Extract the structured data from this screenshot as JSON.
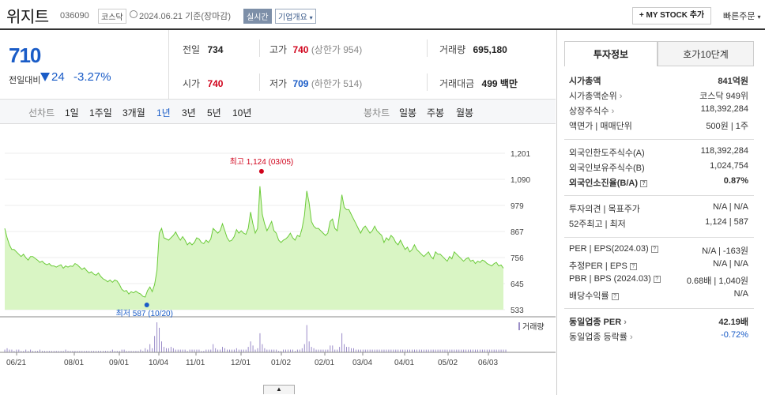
{
  "header": {
    "name": "위지트",
    "code": "036090",
    "market": "코스닥",
    "date_text": "2024.06.21  기준(장마감)",
    "live_tag": "실시간",
    "company_info": "기업개요",
    "mystock_button": "+ MY STOCK 추가",
    "quick_order": "빠른주문"
  },
  "price": {
    "current": "710",
    "change_label": "전일대비",
    "change": "24",
    "change_pct": "-3.27%"
  },
  "stats": {
    "prev_label": "전일",
    "prev": "734",
    "high_label": "고가",
    "high": "740",
    "upper_limit": "(상한가 954)",
    "volume_label": "거래량",
    "volume": "695,180",
    "open_label": "시가",
    "open": "740",
    "low_label": "저가",
    "low": "709",
    "lower_limit": "(하한가 514)",
    "amount_label": "거래대금",
    "amount": "499 백만"
  },
  "toolbar": {
    "line_label": "선차트",
    "periods": [
      "1일",
      "1주일",
      "3개월",
      "1년",
      "3년",
      "5년",
      "10년"
    ],
    "active": "1년",
    "candle_label": "봉차트",
    "candles": [
      "일봉",
      "주봉",
      "월봉"
    ]
  },
  "chart_data": {
    "type": "area",
    "yticks": [
      "1,201",
      "1,090",
      "979",
      "867",
      "756",
      "645",
      "533"
    ],
    "ylim": [
      533,
      1201
    ],
    "xticks": [
      "06/21",
      "08/01",
      "09/01",
      "10/04",
      "11/01",
      "12/01",
      "01/02",
      "02/01",
      "03/04",
      "04/01",
      "05/02",
      "06/03"
    ],
    "high_label": "최고 1,124 (03/05)",
    "low_label": "최저 587 (10/20)",
    "volume_legend": "거래량",
    "values": [
      880,
      840,
      810,
      790,
      790,
      780,
      770,
      760,
      770,
      755,
      745,
      760,
      760,
      752,
      745,
      735,
      740,
      730,
      725,
      730,
      720,
      720,
      715,
      720,
      725,
      710,
      720,
      715,
      720,
      718,
      730,
      725,
      715,
      705,
      712,
      700,
      690,
      695,
      685,
      680,
      690,
      675,
      665,
      660,
      652,
      660,
      650,
      660,
      655,
      640,
      620,
      612,
      615,
      600,
      610,
      605,
      612,
      605,
      600,
      590,
      587,
      615,
      630,
      610,
      640,
      700,
      860,
      880,
      840,
      835,
      830,
      840,
      850,
      865,
      845,
      830,
      845,
      830,
      810,
      820,
      810,
      820,
      840,
      835,
      820,
      815,
      830,
      820,
      835,
      880,
      870,
      860,
      870,
      900,
      870,
      840,
      825,
      830,
      845,
      875,
      860,
      870,
      860,
      855,
      880,
      950,
      900,
      860,
      880,
      1060,
      940,
      900,
      870,
      890,
      910,
      870,
      860,
      830,
      820,
      830,
      835,
      845,
      860,
      840,
      830,
      850,
      845,
      880,
      935,
      1040,
      990,
      910,
      890,
      880,
      880,
      870,
      860,
      850,
      860,
      910,
      920,
      880,
      870,
      940,
      1024,
      970,
      960,
      960,
      940,
      920,
      900,
      880,
      860,
      880,
      890,
      875,
      860,
      870,
      890,
      870,
      860,
      850,
      820,
      840,
      830,
      850,
      840,
      820,
      810,
      830,
      810,
      790,
      800,
      780,
      790,
      810,
      790,
      780,
      770,
      760,
      770,
      780,
      760,
      750,
      780,
      770,
      770,
      760,
      750,
      740,
      760,
      750,
      780,
      770,
      760,
      750,
      740,
      750,
      755,
      740,
      745,
      730,
      740,
      735,
      745,
      740,
      730,
      725,
      720,
      730,
      735,
      720,
      724,
      710
    ],
    "volumes": [
      2,
      3,
      2,
      2,
      1,
      2,
      2,
      1,
      1,
      2,
      1,
      2,
      1,
      1,
      1,
      2,
      1,
      1,
      1,
      1,
      1,
      1,
      1,
      1,
      1,
      1,
      2,
      1,
      1,
      1,
      1,
      1,
      1,
      1,
      1,
      1,
      1,
      1,
      1,
      1,
      1,
      1,
      1,
      1,
      1,
      1,
      2,
      1,
      1,
      1,
      2,
      2,
      1,
      1,
      1,
      1,
      1,
      1,
      2,
      1,
      3,
      2,
      6,
      3,
      12,
      22,
      18,
      8,
      4,
      3,
      3,
      4,
      3,
      2,
      2,
      2,
      2,
      2,
      1,
      2,
      2,
      2,
      2,
      2,
      1,
      1,
      2,
      2,
      2,
      6,
      3,
      2,
      2,
      4,
      3,
      2,
      2,
      2,
      2,
      3,
      2,
      2,
      2,
      2,
      4,
      8,
      5,
      2,
      3,
      14,
      6,
      3,
      2,
      2,
      2,
      2,
      2,
      1,
      1,
      2,
      2,
      2,
      2,
      2,
      1,
      2,
      2,
      3,
      6,
      20,
      8,
      4,
      3,
      2,
      2,
      2,
      2,
      2,
      2,
      5,
      5,
      2,
      2,
      4,
      14,
      6,
      4,
      4,
      3,
      3,
      2,
      2,
      2,
      2,
      2,
      2,
      2,
      2,
      2,
      2,
      2,
      2,
      2,
      2,
      2,
      2,
      2,
      2,
      2,
      2,
      2,
      2,
      2,
      2,
      2,
      2,
      2,
      2,
      2,
      2,
      2,
      2,
      2,
      2,
      2,
      2,
      2,
      2,
      2,
      2,
      2,
      2,
      2,
      2,
      2,
      2,
      2,
      2,
      2,
      2,
      2,
      2,
      2,
      2,
      2,
      2,
      2,
      2,
      2,
      2,
      2,
      2,
      2,
      2,
      2
    ]
  },
  "panel": {
    "tab_invest": "투자정보",
    "tab_orderbook": "호가10단계",
    "rows1": [
      {
        "label": "시가총액",
        "value": "841억원"
      },
      {
        "label": "시가총액순위",
        "value": "코스닥 949위"
      },
      {
        "label": "상장주식수",
        "value": "118,392,284"
      },
      {
        "label": "액면가 | 매매단위",
        "value": "500원  |  1주"
      }
    ],
    "rows2": [
      {
        "label": "외국인한도주식수(A)",
        "value": "118,392,284"
      },
      {
        "label": "외국인보유주식수(B)",
        "value": "1,024,754"
      },
      {
        "label": "외국인소진율(B/A)",
        "value": "0.87%"
      }
    ],
    "rows3": [
      {
        "label": "투자의견 | 목표주가",
        "value": "N/A  |  N/A"
      },
      {
        "label": "52주최고 | 최저",
        "value": "1,124  |  587"
      }
    ],
    "rows4": [
      {
        "label": "PER | EPS(2024.03)",
        "value": "N/A  |  -163원"
      },
      {
        "label": "추정PER | EPS",
        "value": "N/A  |  N/A"
      },
      {
        "label": "PBR | BPS (2024.03)",
        "value": "0.68배  |  1,040원"
      },
      {
        "label": "배당수익률",
        "value": "N/A"
      }
    ],
    "rows5": [
      {
        "label": "동일업종 PER",
        "value": "42.19배"
      },
      {
        "label": "동일업종 등락률",
        "value": "-0.72%"
      }
    ]
  }
}
